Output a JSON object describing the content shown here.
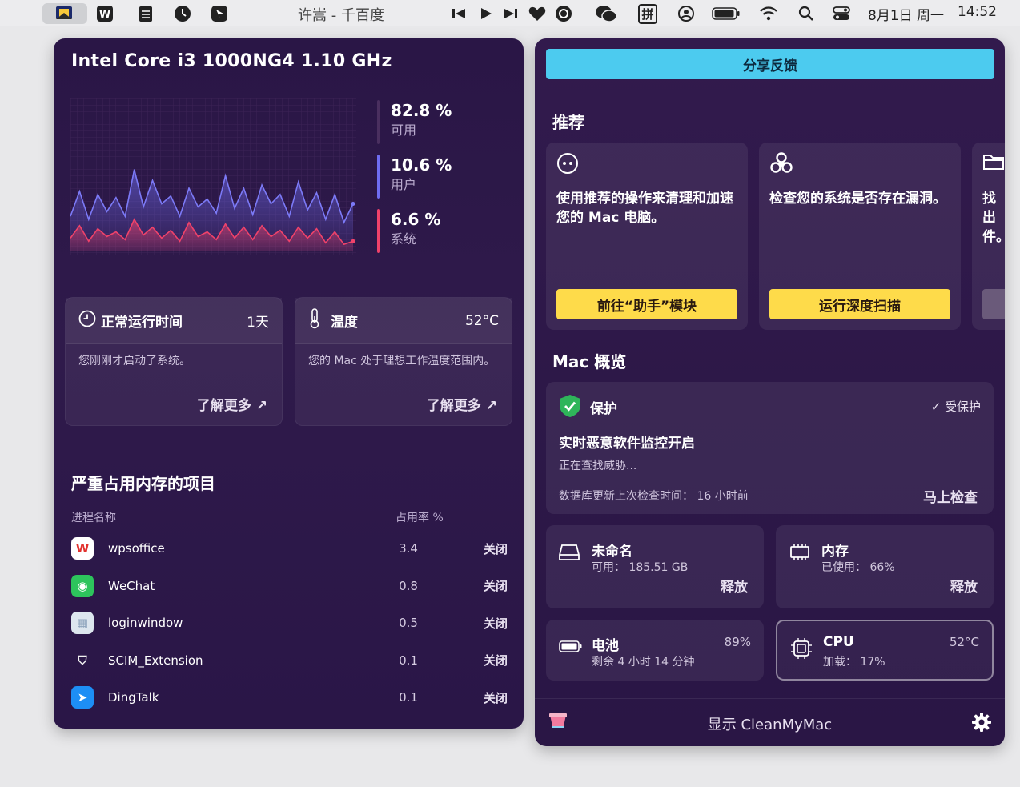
{
  "menubar": {
    "app_title": "许嵩 - 千百度",
    "date": "8月1日 周一",
    "time": "14:52",
    "icons": [
      "finder-scan-icon",
      "wps-icon",
      "notes-icon",
      "clock-icon",
      "dingtalk-icon",
      "prev-track-icon",
      "play-icon",
      "next-track-icon",
      "heart-icon",
      "music-app-icon",
      "wechat-icon",
      "input-method-icon",
      "user-icon",
      "battery-icon",
      "wifi-icon",
      "search-icon",
      "control-center-icon"
    ],
    "input_method": "拼"
  },
  "cpu": {
    "title": "Intel Core i3 1000NG4 1.10 GHz",
    "stats": [
      {
        "value": "82.8 %",
        "label": "可用",
        "color": "#4a2f5f"
      },
      {
        "value": "10.6 %",
        "label": "用户",
        "color": "#6f6df2"
      },
      {
        "value": "6.6 %",
        "label": "系统",
        "color": "#f0426a"
      }
    ],
    "user_series": [
      0.22,
      0.38,
      0.2,
      0.36,
      0.25,
      0.34,
      0.22,
      0.52,
      0.28,
      0.45,
      0.3,
      0.35,
      0.22,
      0.4,
      0.28,
      0.33,
      0.24,
      0.48,
      0.27,
      0.4,
      0.23,
      0.42,
      0.3,
      0.36,
      0.22,
      0.44,
      0.26,
      0.37,
      0.2,
      0.36,
      0.18,
      0.3
    ],
    "system_series": [
      0.08,
      0.16,
      0.06,
      0.14,
      0.09,
      0.12,
      0.07,
      0.2,
      0.1,
      0.15,
      0.08,
      0.13,
      0.06,
      0.18,
      0.09,
      0.12,
      0.07,
      0.17,
      0.08,
      0.15,
      0.07,
      0.16,
      0.09,
      0.13,
      0.06,
      0.15,
      0.08,
      0.14,
      0.05,
      0.12,
      0.04,
      0.06
    ]
  },
  "uptime": {
    "title": "正常运行时间",
    "value": "1天",
    "desc": "您刚刚才启动了系统。",
    "link": "了解更多 ↗"
  },
  "temperature": {
    "title": "温度",
    "value": "52°C",
    "desc": "您的 Mac 处于理想工作温度范围内。",
    "link": "了解更多 ↗"
  },
  "memory_hogs": {
    "title": "严重占用内存的项目",
    "col_name": "进程名称",
    "col_pct": "占用率 %",
    "rows": [
      {
        "name": "wpsoffice",
        "pct": "3.4",
        "action": "关闭",
        "icon": "wps-icon",
        "glyph": "W",
        "bg": "#ffffff",
        "fg": "#e2312d"
      },
      {
        "name": "WeChat",
        "pct": "0.8",
        "action": "关闭",
        "icon": "wechat-icon",
        "glyph": "◉",
        "bg": "#2dc45c",
        "fg": "#ffffff"
      },
      {
        "name": "loginwindow",
        "pct": "0.5",
        "action": "关闭",
        "icon": "loginwindow-icon",
        "glyph": "▦",
        "bg": "#dde6ee",
        "fg": "#8ea4bc"
      },
      {
        "name": "SCIM_Extension",
        "pct": "0.1",
        "action": "关闭",
        "icon": "scim-shield-icon",
        "glyph": "⛉",
        "bg": "transparent",
        "fg": "#f2f2f2"
      },
      {
        "name": "DingTalk",
        "pct": "0.1",
        "action": "关闭",
        "icon": "dingtalk-icon",
        "glyph": "➤",
        "bg": "#1d8ef5",
        "fg": "#ffffff"
      }
    ]
  },
  "right": {
    "share": "分享反馈",
    "rec_title": "推荐",
    "recs": [
      {
        "icon": "assistant-icon",
        "glyph": "⊙",
        "text": "使用推荐的操作来清理和加速您的 Mac 电脑。",
        "button": "前往“助手”模块"
      },
      {
        "icon": "biohazard-icon",
        "glyph": "☣",
        "text": "检查您的系统是否存在漏洞。",
        "button": "运行深度扫描"
      },
      {
        "icon": "folder-icon",
        "glyph": "🗀",
        "text": "找出件。",
        "button": ""
      }
    ],
    "mac_title": "Mac 概览",
    "protection": {
      "title": "保护",
      "status": "✓ 受保护",
      "headline": "实时恶意软件监控开启",
      "sub": "正在查找威胁...",
      "db": "数据库更新上次检查时间：  16 小时前",
      "action": "马上检查"
    },
    "disk": {
      "title": "未命名",
      "sub": "可用：  185.51 GB",
      "action": "释放"
    },
    "ram": {
      "title": "内存",
      "sub": "已使用：  66%",
      "action": "释放"
    },
    "battery": {
      "title": "电池",
      "sub": "剩余 4 小时 14 分钟",
      "value": "89%"
    },
    "cpu": {
      "title": "CPU",
      "sub": "加载：  17%",
      "value": "52°C"
    },
    "footer": "显示 CleanMyMac"
  }
}
